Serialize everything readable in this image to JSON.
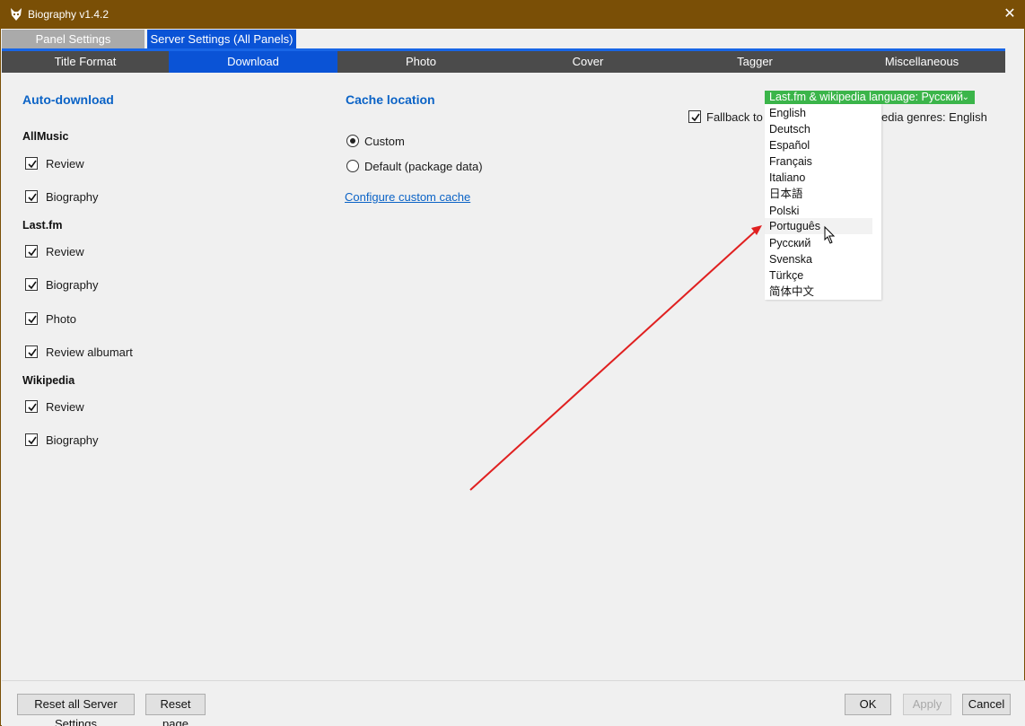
{
  "window": {
    "title": "Biography v1.4.2",
    "close_glyph": "✕",
    "titlebar_color": "#7a4f06",
    "app_icon": "foobar-fox-icon"
  },
  "top_tabs": [
    {
      "label": "Panel Settings",
      "active": false
    },
    {
      "label": "Server Settings (All Panels)",
      "active": true
    }
  ],
  "sub_tabs": [
    {
      "label": "Title Format",
      "active": false
    },
    {
      "label": "Download",
      "active": true
    },
    {
      "label": "Photo",
      "active": false
    },
    {
      "label": "Cover",
      "active": false
    },
    {
      "label": "Tagger",
      "active": false
    },
    {
      "label": "Miscellaneous",
      "active": false
    }
  ],
  "auto_download": {
    "title": "Auto-download",
    "allmusic": {
      "title": "AllMusic",
      "items": [
        {
          "label": "Review",
          "checked": true
        },
        {
          "label": "Biography",
          "checked": true
        }
      ]
    },
    "lastfm": {
      "title": "Last.fm",
      "items": [
        {
          "label": "Review",
          "checked": true
        },
        {
          "label": "Biography",
          "checked": true
        },
        {
          "label": "Photo",
          "checked": true
        },
        {
          "label": "Review albumart",
          "checked": true
        }
      ]
    },
    "wikipedia": {
      "title": "Wikipedia",
      "items": [
        {
          "label": "Review",
          "checked": true
        },
        {
          "label": "Biography",
          "checked": true
        }
      ]
    }
  },
  "cache": {
    "title": "Cache location",
    "options": [
      {
        "label": "Custom",
        "selected": true
      },
      {
        "label": "Default (package data)",
        "selected": false
      }
    ],
    "configure_link": "Configure custom cache"
  },
  "language": {
    "dropdown_label": "Last.fm & wikipedia language: Русский",
    "chevron": "⌄",
    "dropdown_color": "#3bb54a",
    "fallback_label_left": "Fallback to E",
    "fallback_label_right": "edia genres: English",
    "fallback_checked": true,
    "options": [
      "English",
      "Deutsch",
      "Español",
      "Français",
      "Italiano",
      "日本語",
      "Polski",
      "Português",
      "Русский",
      "Svenska",
      "Türkçe",
      "简体中文"
    ],
    "hovered": "Português"
  },
  "annotation": {
    "type": "red-arrow",
    "color": "#e02020"
  },
  "buttons": {
    "reset_all": "Reset all Server Settings",
    "reset_page": "Reset page",
    "ok": "OK",
    "apply": "Apply",
    "cancel": "Cancel"
  }
}
